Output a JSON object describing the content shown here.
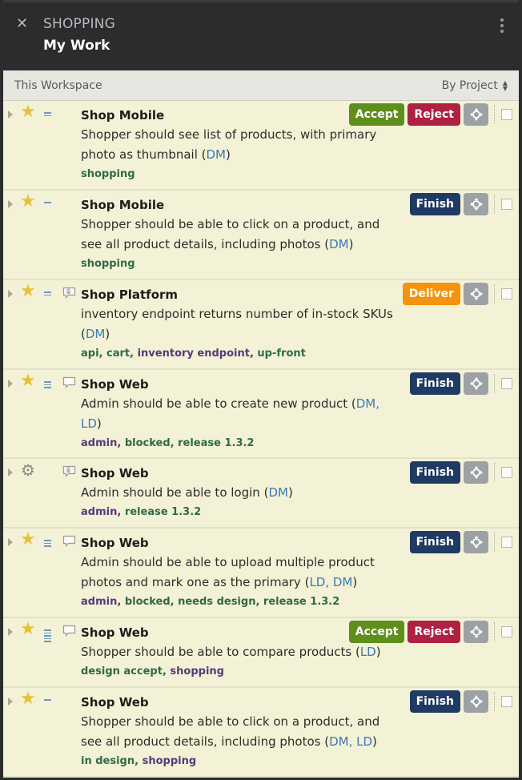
{
  "header": {
    "project": "SHOPPING",
    "title": "My Work",
    "close_icon": "close-icon",
    "menu_icon": "more-vertical-icon"
  },
  "filterbar": {
    "scope": "This Workspace",
    "sort": "By Project"
  },
  "colors": {
    "accept": "#5f8f1b",
    "reject": "#ae2143",
    "finish": "#1f3b63",
    "deliver": "#f4930d",
    "move": "#9ca1a5",
    "row_bg": "#f3f2d6"
  },
  "stories": [
    {
      "type": "feature",
      "project": "Shop Mobile",
      "title": "Shopper should see list of products, with primary photo as thumbnail",
      "owners": "DM",
      "estimate": 2,
      "comment": null,
      "labels": [
        {
          "text": "shopping",
          "color": "green"
        }
      ],
      "actions": [
        "Accept",
        "Reject"
      ]
    },
    {
      "type": "feature",
      "project": "Shop Mobile",
      "title": "Shopper should be able to click on a product, and see all product details, including photos",
      "owners": "DM",
      "estimate": 1,
      "comment": null,
      "labels": [
        {
          "text": "shopping",
          "color": "green"
        }
      ],
      "actions": [
        "Finish"
      ]
    },
    {
      "type": "feature",
      "project": "Shop Platform",
      "title": "inventory endpoint returns number of in-stock SKUs",
      "owners": "DM",
      "estimate": 2,
      "comment": "attachment-comment",
      "labels": [
        {
          "text": "api",
          "color": "green"
        },
        {
          "text": "cart",
          "color": "green"
        },
        {
          "text": "inventory endpoint",
          "color": "purple"
        },
        {
          "text": "up-front",
          "color": "green"
        }
      ],
      "actions": [
        "Deliver"
      ]
    },
    {
      "type": "feature",
      "project": "Shop Web",
      "title": "Admin should be able to create new product",
      "owners": "DM, LD",
      "estimate": 3,
      "comment": "comment",
      "labels": [
        {
          "text": "admin",
          "color": "purple"
        },
        {
          "text": "blocked",
          "color": "green"
        },
        {
          "text": "release 1.3.2",
          "color": "green"
        }
      ],
      "actions": [
        "Finish"
      ]
    },
    {
      "type": "chore",
      "project": "Shop Web",
      "title": "Admin should be able to login",
      "owners": "DM",
      "estimate": 0,
      "comment": "attachment-comment",
      "labels": [
        {
          "text": "admin",
          "color": "purple"
        },
        {
          "text": "release 1.3.2",
          "color": "green"
        }
      ],
      "actions": [
        "Finish"
      ]
    },
    {
      "type": "feature",
      "project": "Shop Web",
      "title": "Admin should be able to upload multiple product photos and mark one as the primary",
      "owners": "LD, DM",
      "estimate": 3,
      "comment": "comment",
      "labels": [
        {
          "text": "admin",
          "color": "purple"
        },
        {
          "text": "blocked",
          "color": "green"
        },
        {
          "text": "needs design",
          "color": "green"
        },
        {
          "text": "release 1.3.2",
          "color": "green"
        }
      ],
      "actions": [
        "Finish"
      ]
    },
    {
      "type": "feature",
      "project": "Shop Web",
      "title": "Shopper should be able to compare products",
      "owners": "LD",
      "estimate": 5,
      "comment": "comment",
      "labels": [
        {
          "text": "design accept",
          "color": "green"
        },
        {
          "text": "shopping",
          "color": "purple"
        }
      ],
      "actions": [
        "Accept",
        "Reject"
      ]
    },
    {
      "type": "feature",
      "project": "Shop Web",
      "title": "Shopper should be able to click on a product, and see all product details, including photos",
      "owners": "DM, LD",
      "estimate": 1,
      "comment": null,
      "labels": [
        {
          "text": "in design",
          "color": "green"
        },
        {
          "text": "shopping",
          "color": "purple"
        }
      ],
      "actions": [
        "Finish"
      ]
    }
  ]
}
